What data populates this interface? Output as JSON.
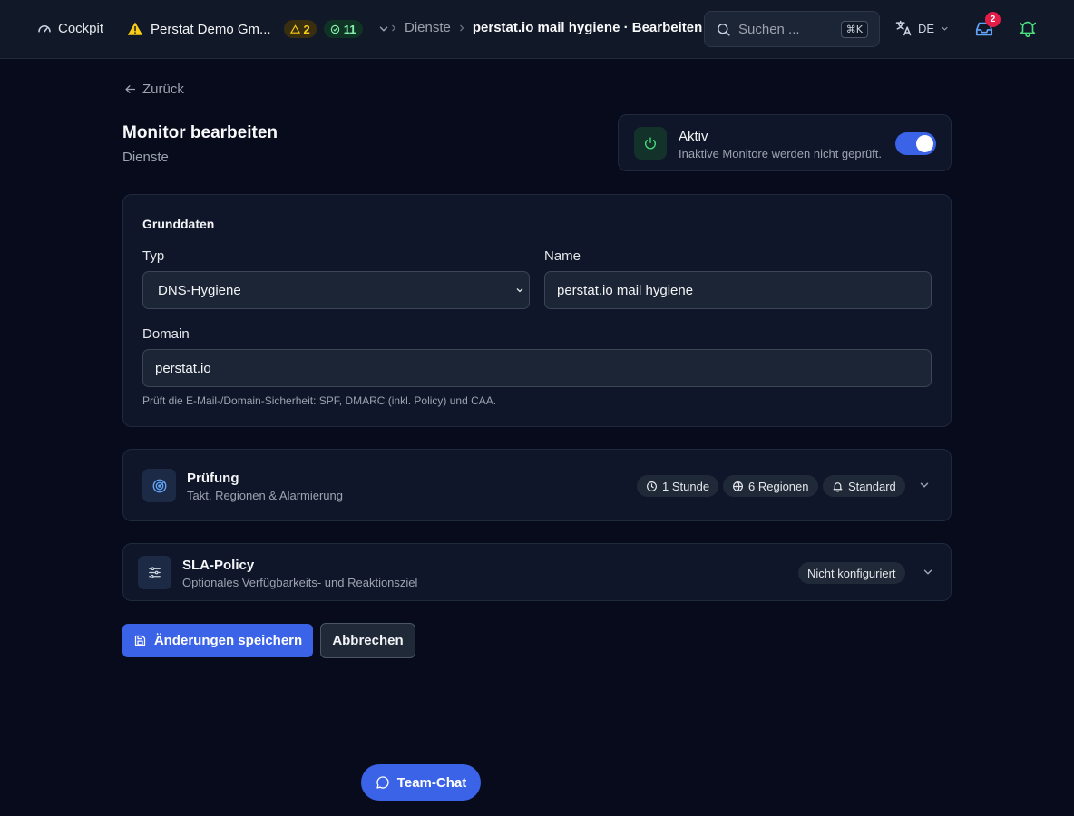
{
  "topbar": {
    "cockpit_label": "Cockpit",
    "org_name": "Perstat Demo Gm...",
    "warning_count": "2",
    "ok_count": "11",
    "breadcrumb": {
      "parent": "Dienste",
      "current": "perstat.io mail hygiene · Bearbeiten"
    },
    "search": {
      "placeholder": "Suchen ...",
      "shortcut": "⌘K"
    },
    "language": "DE",
    "inbox_count": "2"
  },
  "page": {
    "back_label": "Zurück",
    "title": "Monitor bearbeiten",
    "subtitle": "Dienste"
  },
  "active": {
    "title": "Aktiv",
    "description": "Inaktive Monitore werden nicht geprüft.",
    "enabled": true
  },
  "basics": {
    "section_title": "Grunddaten",
    "type_label": "Typ",
    "type_value": "DNS-Hygiene",
    "name_label": "Name",
    "name_value": "perstat.io mail hygiene",
    "domain_label": "Domain",
    "domain_value": "perstat.io",
    "help_text": "Prüft die E-Mail-/Domain-Sicherheit: SPF, DMARC (inkl. Policy) und CAA."
  },
  "check": {
    "title": "Prüfung",
    "description": "Takt, Regionen & Alarmierung",
    "interval": "1 Stunde",
    "regions": "6 Regionen",
    "alerting": "Standard"
  },
  "sla": {
    "title": "SLA-Policy",
    "description": "Optionales Verfügbarkeits- und Reaktionsziel",
    "status": "Nicht konfiguriert"
  },
  "actions": {
    "save_label": "Änderungen speichern",
    "cancel_label": "Abbrechen"
  },
  "chat": {
    "label": "Team-Chat"
  },
  "colors": {
    "accent": "#3b63e8",
    "warning": "#facc15",
    "success": "#86efac",
    "danger": "#e11d48"
  }
}
